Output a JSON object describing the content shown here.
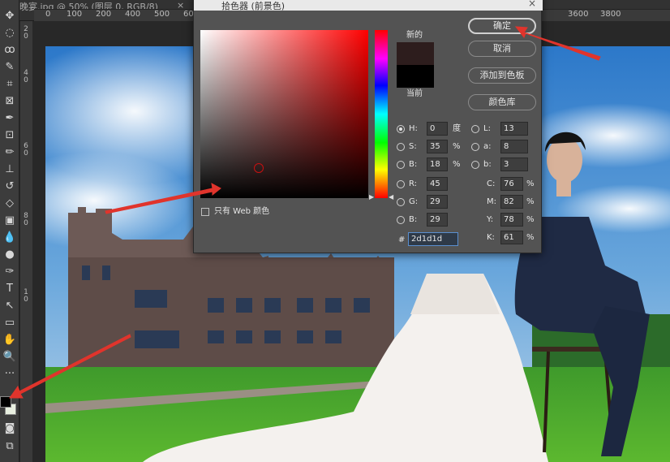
{
  "app": {
    "document_tab": "晚宴.jpg @ 50% (图层 0, RGB/8)",
    "ruler_ticks": [
      "0",
      "100",
      "200",
      "400",
      "500",
      "600"
    ],
    "ruler_ticks_right": [
      "3600",
      "3800"
    ],
    "ruler_v_ticks": [
      "2",
      "0",
      "4",
      "0",
      "6",
      "0",
      "8",
      "0",
      "1",
      "0"
    ]
  },
  "toolbar": {
    "tools": [
      "move-icon",
      "marquee-icon",
      "lasso-icon",
      "quick-select-icon",
      "crop-icon",
      "frame-icon",
      "eyedropper-icon",
      "healing-icon",
      "brush-icon",
      "stamp-icon",
      "history-brush-icon",
      "eraser-icon",
      "gradient-icon",
      "blur-icon",
      "dodge-icon",
      "pen-icon",
      "type-icon",
      "path-select-icon",
      "shape-icon",
      "hand-icon",
      "zoom-icon",
      "more-icon"
    ],
    "foreground_color": "#000000",
    "background_color": "#e8efe0"
  },
  "color_picker": {
    "title": "拾色器 (前景色)",
    "new_label": "新的",
    "current_label": "当前",
    "new_color": "#2d1d1d",
    "current_color": "#000000",
    "ok_label": "确定",
    "cancel_label": "取消",
    "add_swatch_label": "添加到色板",
    "color_libraries_label": "颜色库",
    "web_only_label": "只有 Web 颜色",
    "hsb": {
      "h": "0",
      "h_unit": "度",
      "s": "35",
      "s_unit": "%",
      "b": "18",
      "b_unit": "%"
    },
    "rgb": {
      "r": "45",
      "g": "29",
      "b": "29"
    },
    "lab": {
      "l": "13",
      "a": "8",
      "b": "3"
    },
    "cmyk": {
      "c": "76",
      "m": "82",
      "y": "78",
      "k": "61",
      "unit": "%"
    },
    "hex_prefix": "#",
    "hex": "2d1d1d",
    "labels": {
      "h": "H:",
      "s": "S:",
      "b": "B:",
      "r": "R:",
      "g": "G:",
      "bb": "B:",
      "l": "L:",
      "a": "a:",
      "lb": "b:",
      "c": "C:",
      "m": "M:",
      "y": "Y:",
      "k": "K:"
    },
    "hue_fraction": 0.0,
    "saturation_fraction": 0.35,
    "brightness_fraction": 0.18
  }
}
